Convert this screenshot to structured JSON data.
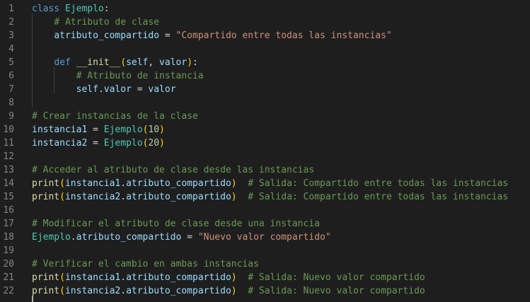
{
  "editor": {
    "language": "python",
    "colors": {
      "background": "#1e1e1e",
      "line_number": "#858585",
      "keyword": "#569cd6",
      "class_name": "#4ec9b0",
      "variable": "#9cdcfe",
      "function": "#dcdcaa",
      "string": "#ce9178",
      "number": "#b5cea8",
      "comment": "#6a9955",
      "bracket": "#ffd700"
    },
    "lines": [
      {
        "n": "1",
        "tokens": [
          [
            "kw",
            "class"
          ],
          [
            "op",
            " "
          ],
          [
            "cls",
            "Ejemplo"
          ],
          [
            "op",
            ":"
          ]
        ]
      },
      {
        "n": "2",
        "tokens": [
          [
            "op",
            "    "
          ],
          [
            "cmt",
            "# Atributo de clase"
          ]
        ]
      },
      {
        "n": "3",
        "tokens": [
          [
            "op",
            "    "
          ],
          [
            "var",
            "atributo_compartido"
          ],
          [
            "op",
            " = "
          ],
          [
            "str",
            "\"Compartido entre todas las instancias\""
          ]
        ]
      },
      {
        "n": "4",
        "tokens": []
      },
      {
        "n": "5",
        "tokens": [
          [
            "op",
            "    "
          ],
          [
            "kw",
            "def"
          ],
          [
            "op",
            " "
          ],
          [
            "fn",
            "__init__"
          ],
          [
            "br1",
            "("
          ],
          [
            "var",
            "self"
          ],
          [
            "op",
            ", "
          ],
          [
            "var",
            "valor"
          ],
          [
            "br1",
            ")"
          ],
          [
            "op",
            ":"
          ]
        ]
      },
      {
        "n": "6",
        "tokens": [
          [
            "op",
            "        "
          ],
          [
            "cmt",
            "# Atributo de instancia"
          ]
        ]
      },
      {
        "n": "7",
        "tokens": [
          [
            "op",
            "        "
          ],
          [
            "var",
            "self"
          ],
          [
            "op",
            "."
          ],
          [
            "var",
            "valor"
          ],
          [
            "op",
            " = "
          ],
          [
            "var",
            "valor"
          ]
        ]
      },
      {
        "n": "8",
        "tokens": []
      },
      {
        "n": "9",
        "tokens": [
          [
            "cmt",
            "# Crear instancias de la clase"
          ]
        ]
      },
      {
        "n": "10",
        "tokens": [
          [
            "var",
            "instancia1"
          ],
          [
            "op",
            " = "
          ],
          [
            "cls",
            "Ejemplo"
          ],
          [
            "br1",
            "("
          ],
          [
            "num",
            "10"
          ],
          [
            "br1",
            ")"
          ]
        ]
      },
      {
        "n": "11",
        "tokens": [
          [
            "var",
            "instancia2"
          ],
          [
            "op",
            " = "
          ],
          [
            "cls",
            "Ejemplo"
          ],
          [
            "br1",
            "("
          ],
          [
            "num",
            "20"
          ],
          [
            "br1",
            ")"
          ]
        ]
      },
      {
        "n": "12",
        "tokens": []
      },
      {
        "n": "13",
        "tokens": [
          [
            "cmt",
            "# Acceder al atributo de clase desde las instancias"
          ]
        ]
      },
      {
        "n": "14",
        "tokens": [
          [
            "fn",
            "print"
          ],
          [
            "br1",
            "("
          ],
          [
            "var",
            "instancia1"
          ],
          [
            "op",
            "."
          ],
          [
            "var",
            "atributo_compartido"
          ],
          [
            "br1",
            ")"
          ],
          [
            "op",
            "  "
          ],
          [
            "cmt",
            "# Salida: Compartido entre todas las instancias"
          ]
        ]
      },
      {
        "n": "15",
        "tokens": [
          [
            "fn",
            "print"
          ],
          [
            "br1",
            "("
          ],
          [
            "var",
            "instancia2"
          ],
          [
            "op",
            "."
          ],
          [
            "var",
            "atributo_compartido"
          ],
          [
            "br1",
            ")"
          ],
          [
            "op",
            "  "
          ],
          [
            "cmt",
            "# Salida: Compartido entre todas las instancias"
          ]
        ]
      },
      {
        "n": "16",
        "tokens": []
      },
      {
        "n": "17",
        "tokens": [
          [
            "cmt",
            "# Modificar el atributo de clase desde una instancia"
          ]
        ]
      },
      {
        "n": "18",
        "tokens": [
          [
            "cls",
            "Ejemplo"
          ],
          [
            "op",
            "."
          ],
          [
            "var",
            "atributo_compartido"
          ],
          [
            "op",
            " = "
          ],
          [
            "str",
            "\"Nuevo valor compartido\""
          ]
        ]
      },
      {
        "n": "19",
        "tokens": []
      },
      {
        "n": "20",
        "tokens": [
          [
            "cmt",
            "# Verificar el cambio en ambas instancias"
          ]
        ]
      },
      {
        "n": "21",
        "tokens": [
          [
            "fn",
            "print"
          ],
          [
            "br1",
            "("
          ],
          [
            "var",
            "instancia1"
          ],
          [
            "op",
            "."
          ],
          [
            "var",
            "atributo_compartido"
          ],
          [
            "br1",
            ")"
          ],
          [
            "op",
            "  "
          ],
          [
            "cmt",
            "# Salida: Nuevo valor compartido"
          ]
        ]
      },
      {
        "n": "22",
        "tokens": [
          [
            "fn",
            "print"
          ],
          [
            "br1",
            "("
          ],
          [
            "var",
            "instancia2"
          ],
          [
            "op",
            "."
          ],
          [
            "var",
            "atributo_compartido"
          ],
          [
            "br1",
            ")"
          ],
          [
            "op",
            "  "
          ],
          [
            "cmt",
            "# Salida: Nuevo valor compartido"
          ]
        ]
      }
    ]
  }
}
